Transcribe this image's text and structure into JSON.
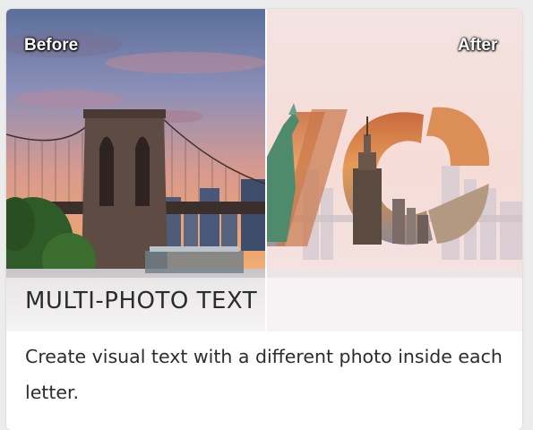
{
  "card": {
    "before_label": "Before",
    "after_label": "After",
    "title": "MULTI-PHOTO TEXT",
    "description": "Create visual text with a different photo inside each letter.",
    "before_image": "brooklyn-bridge-sunset-photo",
    "after_image": "nyc-letters-photo-text"
  },
  "colors": {
    "title_text": "#2c2c2c",
    "label_text": "#ffffff",
    "card_bg": "#ffffff"
  }
}
